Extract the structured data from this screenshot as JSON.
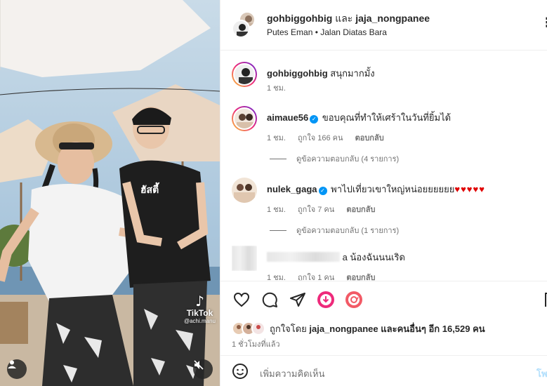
{
  "media": {
    "tiktok_brand": "TikTok",
    "tiktok_handle": "@achi.manu",
    "icons": [
      "user-tag-icon",
      "muted-speaker-icon",
      "tiktok-logo-icon"
    ]
  },
  "header": {
    "user1": "gohbiggohbig",
    "conjunction": "และ",
    "user2": "jaja_nongpanee",
    "location": "Putes Eman • Jalan Diatas Bara",
    "more_icon": "more-options-icon"
  },
  "comments": [
    {
      "username": "gohbiggohbig",
      "text": "สนุกมากมั้ง",
      "verified": false,
      "time": "1 ชม.",
      "likes": "",
      "reply_label": ""
    },
    {
      "username": "aimaue56",
      "text": "ขอบคุณที่ทำให้เศร้าในวันที่ยิ้มได้",
      "verified": true,
      "time": "1 ชม.",
      "likes": "ถูกใจ 166 คน",
      "reply_label": "ตอบกลับ",
      "view_replies": "ดูข้อความตอบกลับ (4 รายการ)"
    },
    {
      "username": "nulek_gaga",
      "text": "พาไปเที่ยวเขาใหญ่หน่อยยยยยย",
      "hearts": "♥♥♥♥♥",
      "verified": true,
      "time": "1 ชม.",
      "likes": "ถูกใจ 7 คน",
      "reply_label": "ตอบกลับ",
      "view_replies": "ดูข้อความตอบกลับ (1 รายการ)"
    },
    {
      "username": "",
      "text": "a น้องฉันนนเริด",
      "verified": false,
      "time": "1 ชม.",
      "likes": "ถูกใจ 1 คน",
      "reply_label": "ตอบกลับ"
    }
  ],
  "actions": {
    "icons": [
      "heart-icon",
      "comment-icon",
      "share-icon",
      "download-icon",
      "repost-icon",
      "bookmark-icon"
    ],
    "liked_by_prefix": "ถูกใจโดย",
    "liked_by_user": "jaja_nongpanee",
    "liked_by_and": "และ",
    "liked_by_others": "คนอื่นๆ อีก 16,529 คน",
    "timestamp": "1 ชั่วโมงที่แล้ว"
  },
  "add_comment": {
    "placeholder": "เพิ่มความคิดเห็น",
    "post_label": "โพ",
    "emoji_icon": "emoji-icon"
  },
  "colors": {
    "accent": "#0095f6",
    "heart_red": "#e00000",
    "meta_gray": "#737373",
    "divider": "#efefef"
  }
}
